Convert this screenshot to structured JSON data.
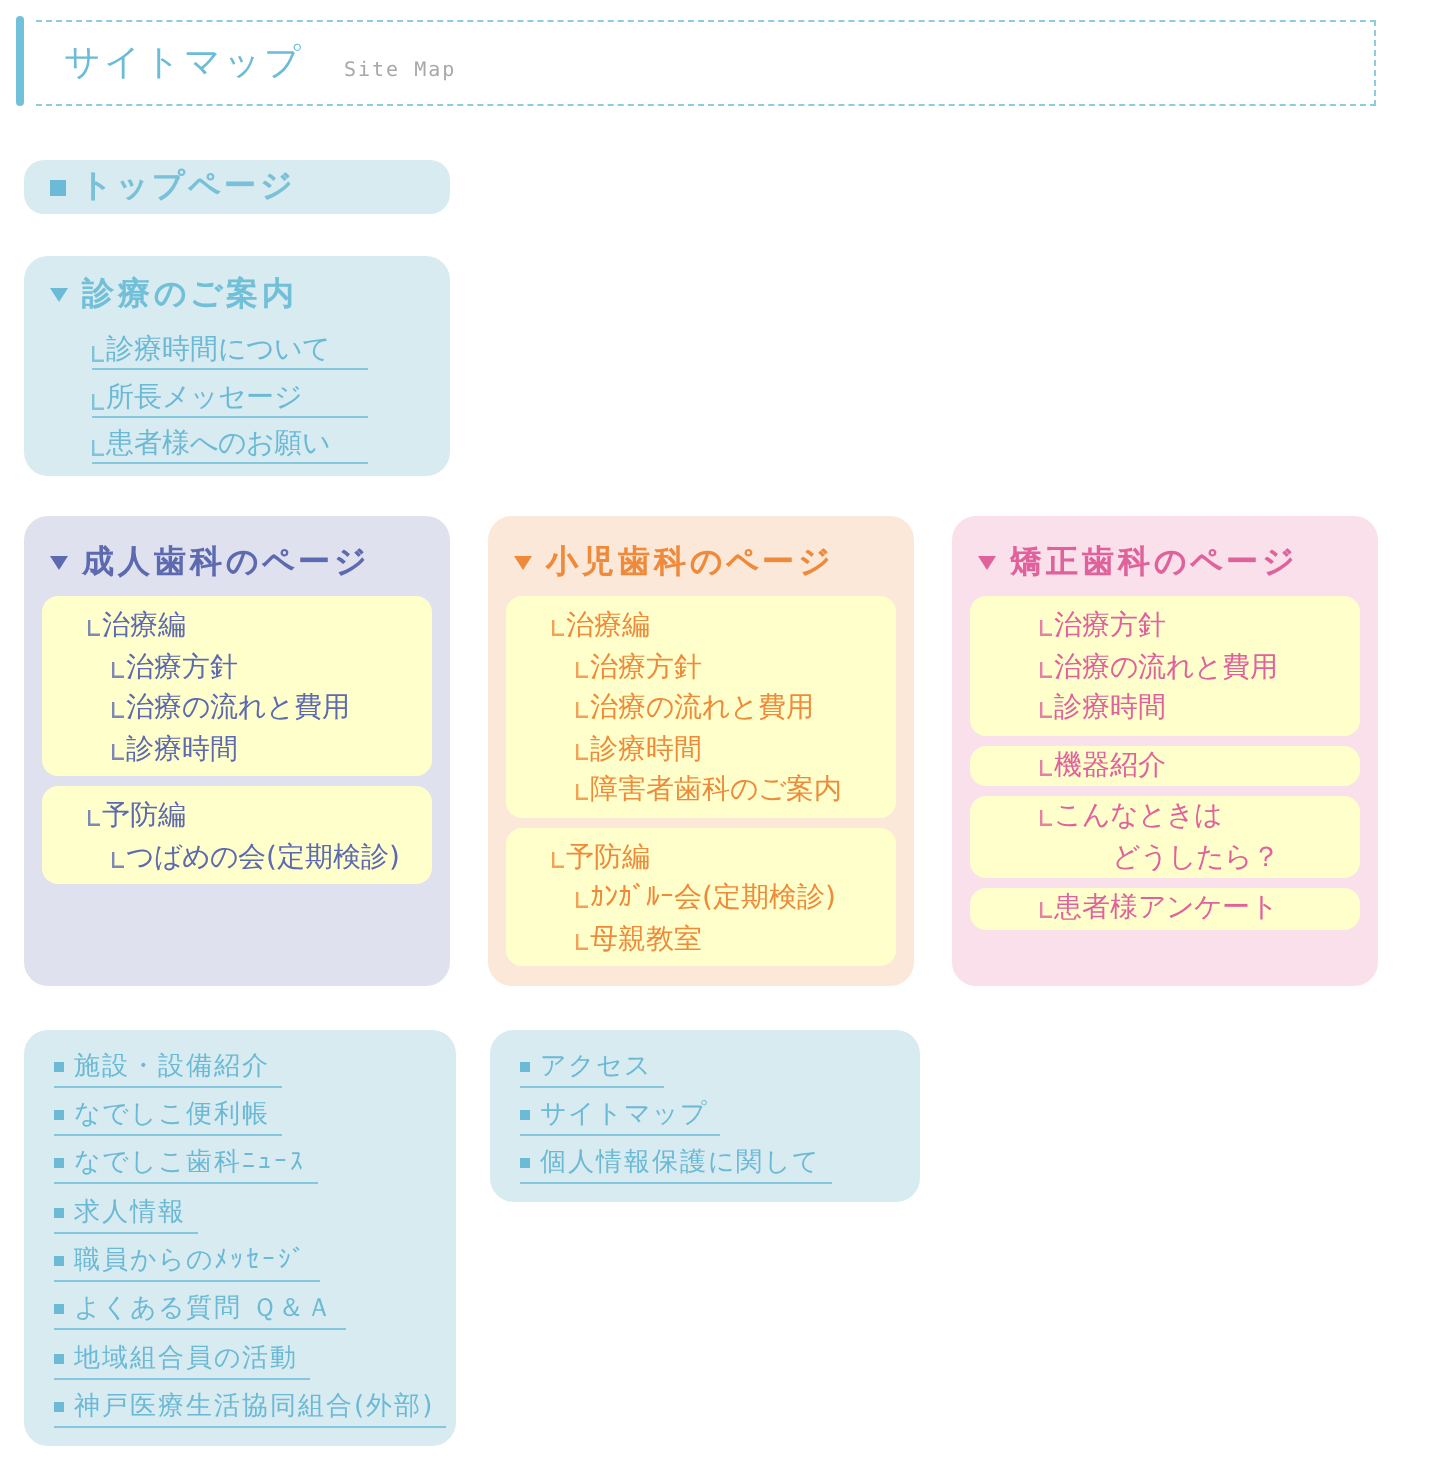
{
  "header": {
    "title": "サイトマップ",
    "subtitle": "Site Map"
  },
  "top_link": {
    "label": "トップページ"
  },
  "guide": {
    "title": "診療のご案内",
    "links": [
      "診療時間について",
      "所長メッセージ",
      "患者様へのお願い"
    ]
  },
  "departments": [
    {
      "title": "成人歯科のページ",
      "color": "#5d6ab0",
      "sections": [
        {
          "items": [
            {
              "label": "治療編",
              "children": [
                {
                  "label": "治療方針"
                },
                {
                  "label": "治療の流れと費用"
                },
                {
                  "label": "診療時間"
                }
              ]
            }
          ]
        },
        {
          "items": [
            {
              "label": "予防編",
              "children": [
                {
                  "label": "つばめの会(定期検診)"
                }
              ]
            }
          ]
        }
      ]
    },
    {
      "title": "小児歯科のページ",
      "color": "#ef8a3a",
      "sections": [
        {
          "items": [
            {
              "label": "治療編",
              "children": [
                {
                  "label": "治療方針"
                },
                {
                  "label": "治療の流れと費用"
                },
                {
                  "label": "診療時間"
                },
                {
                  "label": "障害者歯科のご案内"
                }
              ]
            }
          ]
        },
        {
          "items": [
            {
              "label": "予防編",
              "children": [
                {
                  "label": "ｶﾝｶﾞﾙｰ会(定期検診)"
                },
                {
                  "label": "母親教室"
                }
              ]
            }
          ]
        }
      ]
    },
    {
      "title": "矯正歯科のページ",
      "color": "#e0629c",
      "sections": [
        {
          "items": [
            {
              "label": "治療方針"
            },
            {
              "label": "治療の流れと費用"
            },
            {
              "label": "診療時間"
            }
          ]
        },
        {
          "items": [
            {
              "label": "機器紹介"
            }
          ]
        },
        {
          "items": [
            {
              "lines": [
                "こんなときは",
                "どうしたら？"
              ]
            }
          ]
        },
        {
          "items": [
            {
              "label": "患者様アンケート"
            }
          ]
        }
      ]
    }
  ],
  "link_lists": [
    [
      "施設・設備紹介",
      "なでしこ便利帳",
      "なでしこ歯科ﾆｭｰｽ",
      "求人情報",
      "職員からのﾒｯｾｰｼﾞ",
      "よくある質問 Ｑ＆Ａ",
      "地域組合員の活動",
      "神戸医療生活協同組合(外部)"
    ],
    [
      "アクセス",
      "サイトマップ",
      "個人情報保護に関して"
    ]
  ]
}
